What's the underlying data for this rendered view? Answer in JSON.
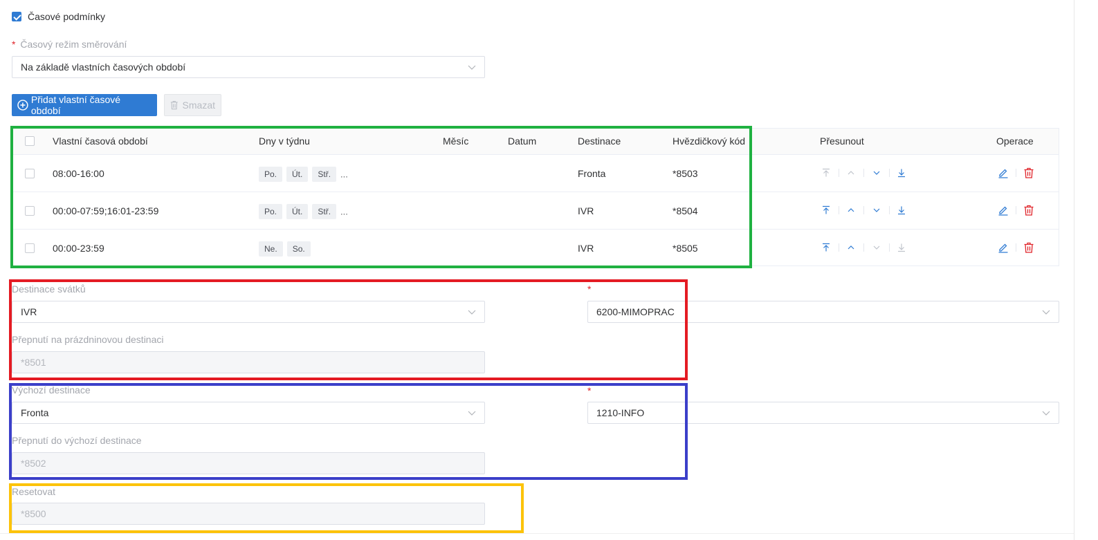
{
  "time_conditions": {
    "checkbox_label": "Časové podmínky",
    "checked": true
  },
  "routing_mode": {
    "label": "Časový režim směrování",
    "required_mark": "*",
    "value": "Na základě vlastních časových období"
  },
  "toolbar": {
    "add_label": "Přidat vlastní časové období",
    "delete_label": "Smazat"
  },
  "table": {
    "headers": {
      "period": "Vlastní časová období",
      "days": "Dny v týdnu",
      "month": "Měsíc",
      "date": "Datum",
      "destination": "Destinace",
      "star_code": "Hvězdičkový kód",
      "move": "Přesunout",
      "operations": "Operace"
    },
    "rows": [
      {
        "period": "08:00-16:00",
        "days": [
          "Po.",
          "Út.",
          "Stř."
        ],
        "more": "...",
        "destination": "Fronta",
        "star_code": "*8503"
      },
      {
        "period": "00:00-07:59;16:01-23:59",
        "days": [
          "Po.",
          "Út.",
          "Stř."
        ],
        "more": "...",
        "destination": "IVR",
        "star_code": "*8504"
      },
      {
        "period": "00:00-23:59",
        "days": [
          "Ne.",
          "So."
        ],
        "more": "",
        "destination": "IVR",
        "star_code": "*8505"
      }
    ]
  },
  "holiday": {
    "label": "Destinace svátků",
    "type_value": "IVR",
    "required_mark": "*",
    "target_value": "6200-MIMOPRAC",
    "switch_label": "Přepnutí na prázdninovou destinaci",
    "switch_value": "*8501"
  },
  "default_dest": {
    "label": "Výchozí destinace",
    "type_value": "Fronta",
    "required_mark": "*",
    "target_value": "1210-INFO",
    "switch_label": "Přepnutí do výchozí destinace",
    "switch_value": "*8502"
  },
  "reset": {
    "label": "Resetovat",
    "value": "*8500"
  },
  "colors": {
    "primary": "#2f7bd3",
    "danger": "#e0242a",
    "frame_green": "#1fb141",
    "frame_red": "#e41b23",
    "frame_blue": "#3b3fc9",
    "frame_yellow": "#fcc30a"
  },
  "icons": {
    "add": "plus-circle-icon",
    "delete": "trash-icon",
    "move": [
      "move-top-icon",
      "move-up-icon",
      "move-down-icon",
      "move-bottom-icon"
    ],
    "edit": "edit-icon",
    "remove": "delete-icon",
    "select": "chevron-down-icon"
  }
}
